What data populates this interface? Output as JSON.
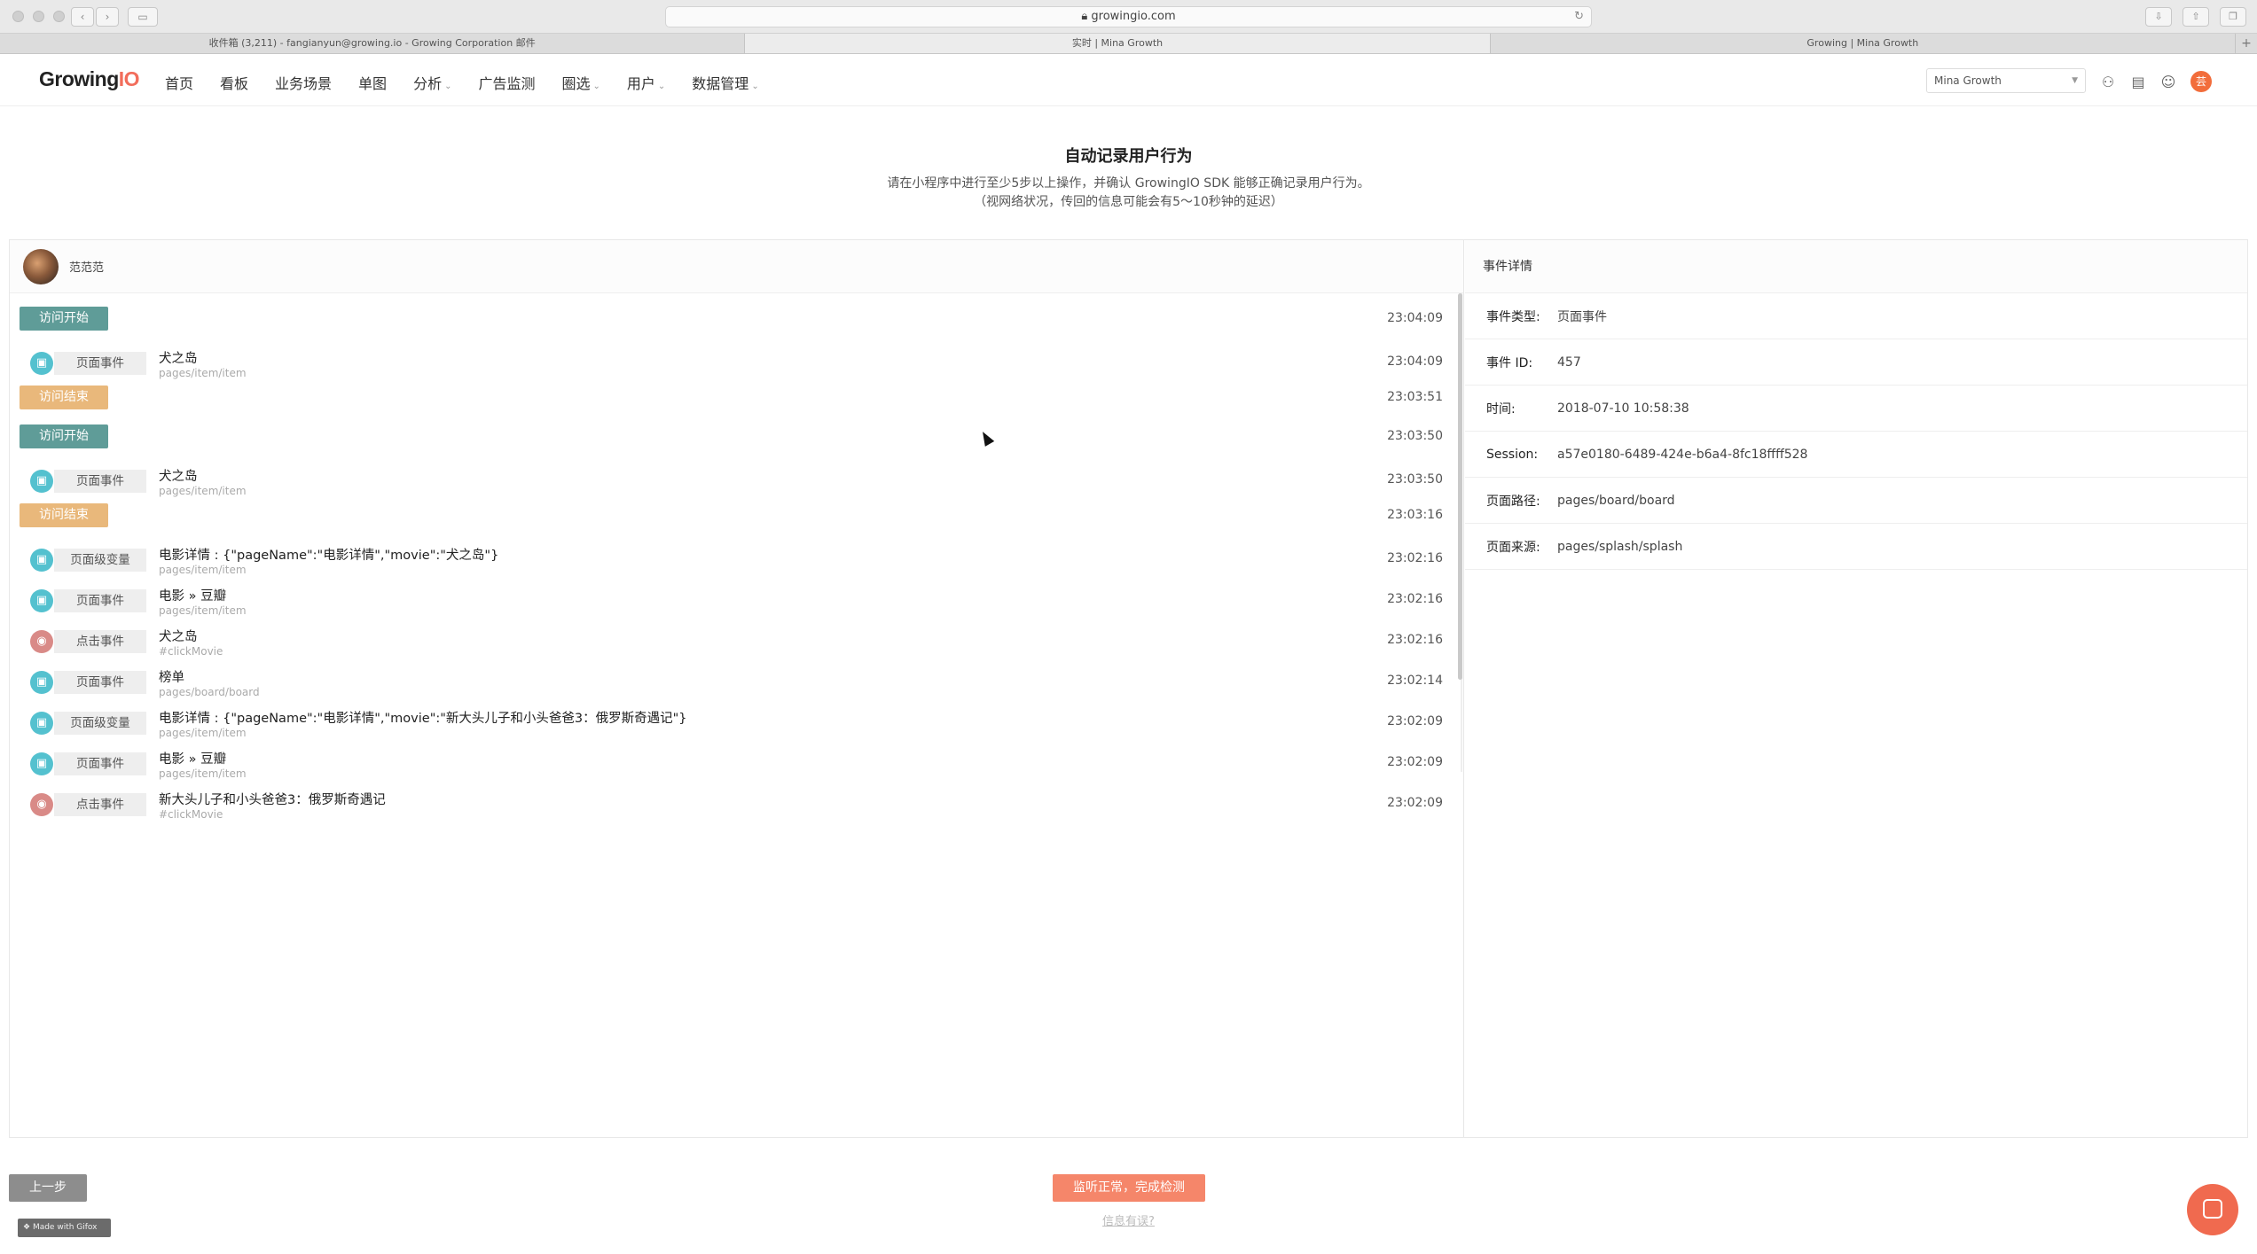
{
  "browser": {
    "url": "growingio.com",
    "tabs": [
      "收件箱 (3,211) - fangianyun@growing.io - Growing Corporation 邮件",
      "实时 | Mina Growth",
      "Growing | Mina Growth"
    ],
    "add_tab": "+"
  },
  "nav": {
    "logo_main": "Growing",
    "logo_accent": "IO",
    "menu": [
      "首页",
      "看板",
      "业务场景",
      "单图",
      "分析",
      "广告监测",
      "圈选",
      "用户",
      "数据管理"
    ],
    "project": "Mina Growth",
    "avatar_initial": "芸"
  },
  "header": {
    "title": "自动记录用户行为",
    "desc_line1": "请在小程序中进行至少5步以上操作，并确认 GrowingIO SDK 能够正确记录用户行为。",
    "desc_line2": "（视网络状况，传回的信息可能会有5～10秒钟的延迟）"
  },
  "user": {
    "name": "范范范"
  },
  "events": [
    {
      "kind": "start",
      "label": "访问开始",
      "time": "23:04:09"
    },
    {
      "kind": "page",
      "tag": "页面事件",
      "title": "犬之岛",
      "sub": "pages/item/item",
      "time": "23:04:09"
    },
    {
      "kind": "end",
      "label": "访问结束",
      "time": "23:03:51"
    },
    {
      "kind": "start",
      "label": "访问开始",
      "time": "23:03:50"
    },
    {
      "kind": "page",
      "tag": "页面事件",
      "title": "犬之岛",
      "sub": "pages/item/item",
      "time": "23:03:50"
    },
    {
      "kind": "end",
      "label": "访问结束",
      "time": "23:03:16"
    },
    {
      "kind": "page",
      "tag": "页面级变量",
      "title": "电影详情 : {\"pageName\":\"电影详情\",\"movie\":\"犬之岛\"}",
      "sub": "pages/item/item",
      "time": "23:02:16"
    },
    {
      "kind": "page",
      "tag": "页面事件",
      "title": "电影 » 豆瓣",
      "sub": "pages/item/item",
      "time": "23:02:16"
    },
    {
      "kind": "click",
      "tag": "点击事件",
      "title": "犬之岛",
      "sub": "#clickMovie",
      "time": "23:02:16"
    },
    {
      "kind": "page",
      "tag": "页面事件",
      "title": "榜单",
      "sub": "pages/board/board",
      "time": "23:02:14"
    },
    {
      "kind": "page",
      "tag": "页面级变量",
      "title": "电影详情 : {\"pageName\":\"电影详情\",\"movie\":\"新大头儿子和小头爸爸3：俄罗斯奇遇记\"}",
      "sub": "pages/item/item",
      "time": "23:02:09"
    },
    {
      "kind": "page",
      "tag": "页面事件",
      "title": "电影 » 豆瓣",
      "sub": "pages/item/item",
      "time": "23:02:09"
    },
    {
      "kind": "click",
      "tag": "点击事件",
      "title": "新大头儿子和小头爸爸3：俄罗斯奇遇记",
      "sub": "#clickMovie",
      "time": "23:02:09"
    }
  ],
  "detail": {
    "heading": "事件详情",
    "rows": [
      {
        "key": "事件类型:",
        "value": "页面事件"
      },
      {
        "key": "事件 ID:",
        "value": "457"
      },
      {
        "key": "时间:",
        "value": "2018-07-10 10:58:38"
      },
      {
        "key": "Session:",
        "value": "a57e0180-6489-424e-b6a4-8fc18ffff528"
      },
      {
        "key": "页面路径:",
        "value": "pages/board/board"
      },
      {
        "key": "页面来源:",
        "value": "pages/splash/splash"
      }
    ]
  },
  "footer": {
    "prev": "上一步",
    "finish": "监听正常，完成检测",
    "wrong_info": "信息有误?",
    "made_with": "Made with Gifox"
  },
  "icons": {
    "page_event": "page-icon",
    "click_event": "click-icon",
    "nav": [
      "team-icon",
      "document-icon",
      "support-icon"
    ]
  },
  "colors": {
    "start_badge": "#5f9c98",
    "end_badge": "#e9b87b",
    "page_icon": "#54c1cf",
    "click_icon": "#d98a87",
    "finish_button": "#f5866a",
    "accent": "#f26d5b"
  }
}
